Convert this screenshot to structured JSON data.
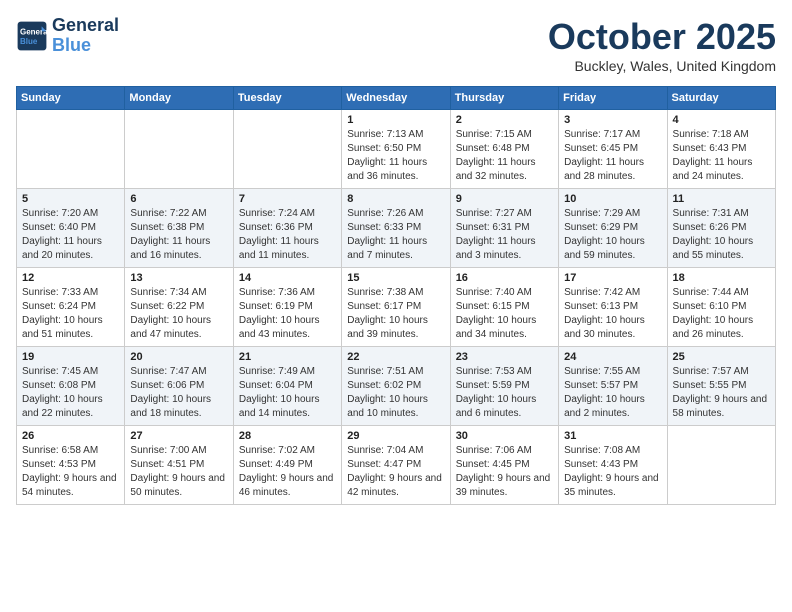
{
  "header": {
    "logo_line1": "General",
    "logo_line2": "Blue",
    "month": "October 2025",
    "location": "Buckley, Wales, United Kingdom"
  },
  "days_of_week": [
    "Sunday",
    "Monday",
    "Tuesday",
    "Wednesday",
    "Thursday",
    "Friday",
    "Saturday"
  ],
  "weeks": [
    [
      {
        "day": "",
        "sunrise": "",
        "sunset": "",
        "daylight": ""
      },
      {
        "day": "",
        "sunrise": "",
        "sunset": "",
        "daylight": ""
      },
      {
        "day": "",
        "sunrise": "",
        "sunset": "",
        "daylight": ""
      },
      {
        "day": "1",
        "sunrise": "Sunrise: 7:13 AM",
        "sunset": "Sunset: 6:50 PM",
        "daylight": "Daylight: 11 hours and 36 minutes."
      },
      {
        "day": "2",
        "sunrise": "Sunrise: 7:15 AM",
        "sunset": "Sunset: 6:48 PM",
        "daylight": "Daylight: 11 hours and 32 minutes."
      },
      {
        "day": "3",
        "sunrise": "Sunrise: 7:17 AM",
        "sunset": "Sunset: 6:45 PM",
        "daylight": "Daylight: 11 hours and 28 minutes."
      },
      {
        "day": "4",
        "sunrise": "Sunrise: 7:18 AM",
        "sunset": "Sunset: 6:43 PM",
        "daylight": "Daylight: 11 hours and 24 minutes."
      }
    ],
    [
      {
        "day": "5",
        "sunrise": "Sunrise: 7:20 AM",
        "sunset": "Sunset: 6:40 PM",
        "daylight": "Daylight: 11 hours and 20 minutes."
      },
      {
        "day": "6",
        "sunrise": "Sunrise: 7:22 AM",
        "sunset": "Sunset: 6:38 PM",
        "daylight": "Daylight: 11 hours and 16 minutes."
      },
      {
        "day": "7",
        "sunrise": "Sunrise: 7:24 AM",
        "sunset": "Sunset: 6:36 PM",
        "daylight": "Daylight: 11 hours and 11 minutes."
      },
      {
        "day": "8",
        "sunrise": "Sunrise: 7:26 AM",
        "sunset": "Sunset: 6:33 PM",
        "daylight": "Daylight: 11 hours and 7 minutes."
      },
      {
        "day": "9",
        "sunrise": "Sunrise: 7:27 AM",
        "sunset": "Sunset: 6:31 PM",
        "daylight": "Daylight: 11 hours and 3 minutes."
      },
      {
        "day": "10",
        "sunrise": "Sunrise: 7:29 AM",
        "sunset": "Sunset: 6:29 PM",
        "daylight": "Daylight: 10 hours and 59 minutes."
      },
      {
        "day": "11",
        "sunrise": "Sunrise: 7:31 AM",
        "sunset": "Sunset: 6:26 PM",
        "daylight": "Daylight: 10 hours and 55 minutes."
      }
    ],
    [
      {
        "day": "12",
        "sunrise": "Sunrise: 7:33 AM",
        "sunset": "Sunset: 6:24 PM",
        "daylight": "Daylight: 10 hours and 51 minutes."
      },
      {
        "day": "13",
        "sunrise": "Sunrise: 7:34 AM",
        "sunset": "Sunset: 6:22 PM",
        "daylight": "Daylight: 10 hours and 47 minutes."
      },
      {
        "day": "14",
        "sunrise": "Sunrise: 7:36 AM",
        "sunset": "Sunset: 6:19 PM",
        "daylight": "Daylight: 10 hours and 43 minutes."
      },
      {
        "day": "15",
        "sunrise": "Sunrise: 7:38 AM",
        "sunset": "Sunset: 6:17 PM",
        "daylight": "Daylight: 10 hours and 39 minutes."
      },
      {
        "day": "16",
        "sunrise": "Sunrise: 7:40 AM",
        "sunset": "Sunset: 6:15 PM",
        "daylight": "Daylight: 10 hours and 34 minutes."
      },
      {
        "day": "17",
        "sunrise": "Sunrise: 7:42 AM",
        "sunset": "Sunset: 6:13 PM",
        "daylight": "Daylight: 10 hours and 30 minutes."
      },
      {
        "day": "18",
        "sunrise": "Sunrise: 7:44 AM",
        "sunset": "Sunset: 6:10 PM",
        "daylight": "Daylight: 10 hours and 26 minutes."
      }
    ],
    [
      {
        "day": "19",
        "sunrise": "Sunrise: 7:45 AM",
        "sunset": "Sunset: 6:08 PM",
        "daylight": "Daylight: 10 hours and 22 minutes."
      },
      {
        "day": "20",
        "sunrise": "Sunrise: 7:47 AM",
        "sunset": "Sunset: 6:06 PM",
        "daylight": "Daylight: 10 hours and 18 minutes."
      },
      {
        "day": "21",
        "sunrise": "Sunrise: 7:49 AM",
        "sunset": "Sunset: 6:04 PM",
        "daylight": "Daylight: 10 hours and 14 minutes."
      },
      {
        "day": "22",
        "sunrise": "Sunrise: 7:51 AM",
        "sunset": "Sunset: 6:02 PM",
        "daylight": "Daylight: 10 hours and 10 minutes."
      },
      {
        "day": "23",
        "sunrise": "Sunrise: 7:53 AM",
        "sunset": "Sunset: 5:59 PM",
        "daylight": "Daylight: 10 hours and 6 minutes."
      },
      {
        "day": "24",
        "sunrise": "Sunrise: 7:55 AM",
        "sunset": "Sunset: 5:57 PM",
        "daylight": "Daylight: 10 hours and 2 minutes."
      },
      {
        "day": "25",
        "sunrise": "Sunrise: 7:57 AM",
        "sunset": "Sunset: 5:55 PM",
        "daylight": "Daylight: 9 hours and 58 minutes."
      }
    ],
    [
      {
        "day": "26",
        "sunrise": "Sunrise: 6:58 AM",
        "sunset": "Sunset: 4:53 PM",
        "daylight": "Daylight: 9 hours and 54 minutes."
      },
      {
        "day": "27",
        "sunrise": "Sunrise: 7:00 AM",
        "sunset": "Sunset: 4:51 PM",
        "daylight": "Daylight: 9 hours and 50 minutes."
      },
      {
        "day": "28",
        "sunrise": "Sunrise: 7:02 AM",
        "sunset": "Sunset: 4:49 PM",
        "daylight": "Daylight: 9 hours and 46 minutes."
      },
      {
        "day": "29",
        "sunrise": "Sunrise: 7:04 AM",
        "sunset": "Sunset: 4:47 PM",
        "daylight": "Daylight: 9 hours and 42 minutes."
      },
      {
        "day": "30",
        "sunrise": "Sunrise: 7:06 AM",
        "sunset": "Sunset: 4:45 PM",
        "daylight": "Daylight: 9 hours and 39 minutes."
      },
      {
        "day": "31",
        "sunrise": "Sunrise: 7:08 AM",
        "sunset": "Sunset: 4:43 PM",
        "daylight": "Daylight: 9 hours and 35 minutes."
      },
      {
        "day": "",
        "sunrise": "",
        "sunset": "",
        "daylight": ""
      }
    ]
  ]
}
